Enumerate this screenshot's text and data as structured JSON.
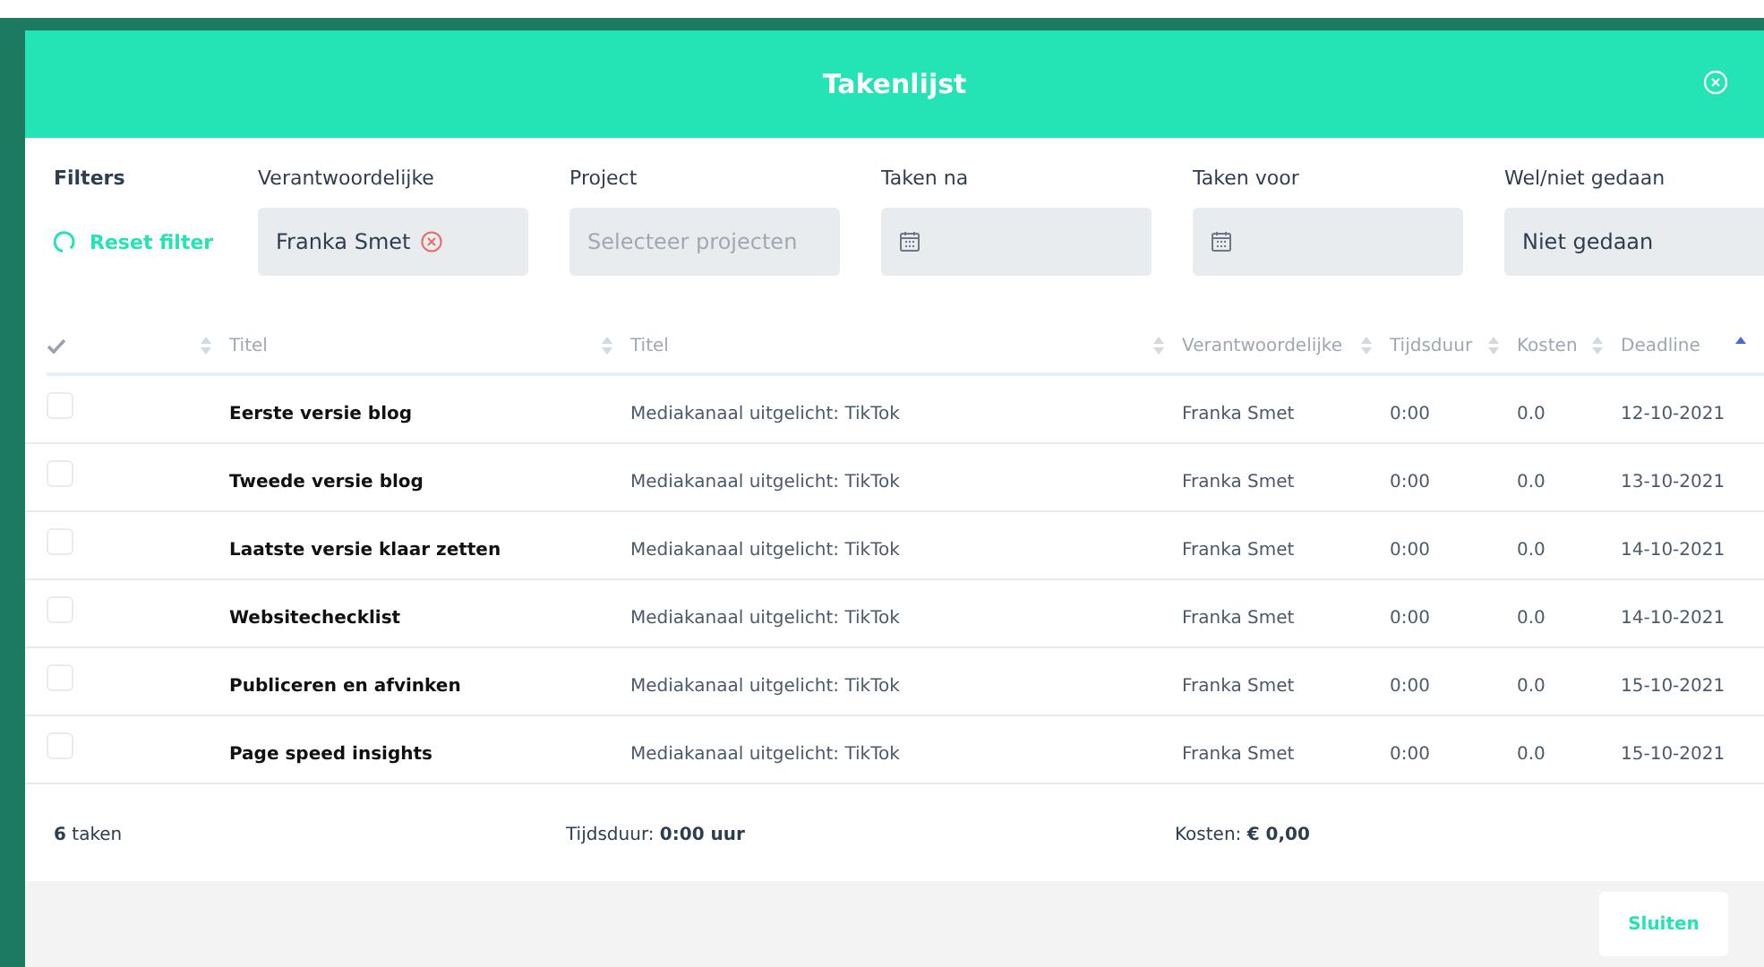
{
  "modal": {
    "title": "Takenlijst"
  },
  "filters": {
    "label": "Filters",
    "reset": "Reset filter",
    "fields": [
      {
        "label": "Verantwoordelijke",
        "kind": "chip",
        "value": "Franka Smet"
      },
      {
        "label": "Project",
        "kind": "placeholder",
        "placeholder": "Selecteer projecten"
      },
      {
        "label": "Taken na",
        "kind": "date"
      },
      {
        "label": "Taken voor",
        "kind": "date"
      },
      {
        "label": "Wel/niet gedaan",
        "kind": "value",
        "value": "Niet gedaan"
      }
    ]
  },
  "table": {
    "check_header": {
      "sorted": false
    },
    "columns": [
      {
        "label": "Titel",
        "sorted": false
      },
      {
        "label": "Titel",
        "sorted": false
      },
      {
        "label": "Verantwoordelijke",
        "sorted": false
      },
      {
        "label": "Tijdsduur",
        "sorted": false
      },
      {
        "label": "Kosten",
        "sorted": false
      },
      {
        "label": "Deadline",
        "sorted": true
      }
    ],
    "rows": [
      {
        "checked": false,
        "cells": [
          "Eerste versie blog",
          "Mediakanaal uitgelicht: TikTok",
          "Franka Smet",
          "0:00",
          "0.0",
          "12-10-2021"
        ]
      },
      {
        "checked": false,
        "cells": [
          "Tweede versie blog",
          "Mediakanaal uitgelicht: TikTok",
          "Franka Smet",
          "0:00",
          "0.0",
          "13-10-2021"
        ]
      },
      {
        "checked": false,
        "cells": [
          "Laatste versie klaar zetten",
          "Mediakanaal uitgelicht: TikTok",
          "Franka Smet",
          "0:00",
          "0.0",
          "14-10-2021"
        ]
      },
      {
        "checked": false,
        "cells": [
          "Websitechecklist",
          "Mediakanaal uitgelicht: TikTok",
          "Franka Smet",
          "0:00",
          "0.0",
          "14-10-2021"
        ]
      },
      {
        "checked": false,
        "cells": [
          "Publiceren en afvinken",
          "Mediakanaal uitgelicht: TikTok",
          "Franka Smet",
          "0:00",
          "0.0",
          "15-10-2021"
        ]
      },
      {
        "checked": false,
        "cells": [
          "Page speed insights",
          "Mediakanaal uitgelicht: TikTok",
          "Franka Smet",
          "0:00",
          "0.0",
          "15-10-2021"
        ]
      }
    ]
  },
  "summary": [
    "**6** taken",
    "Tijdsduur: **0:00 uur**",
    "Kosten: **€ 0,00**"
  ],
  "buttons": [
    "Sluiten"
  ]
}
